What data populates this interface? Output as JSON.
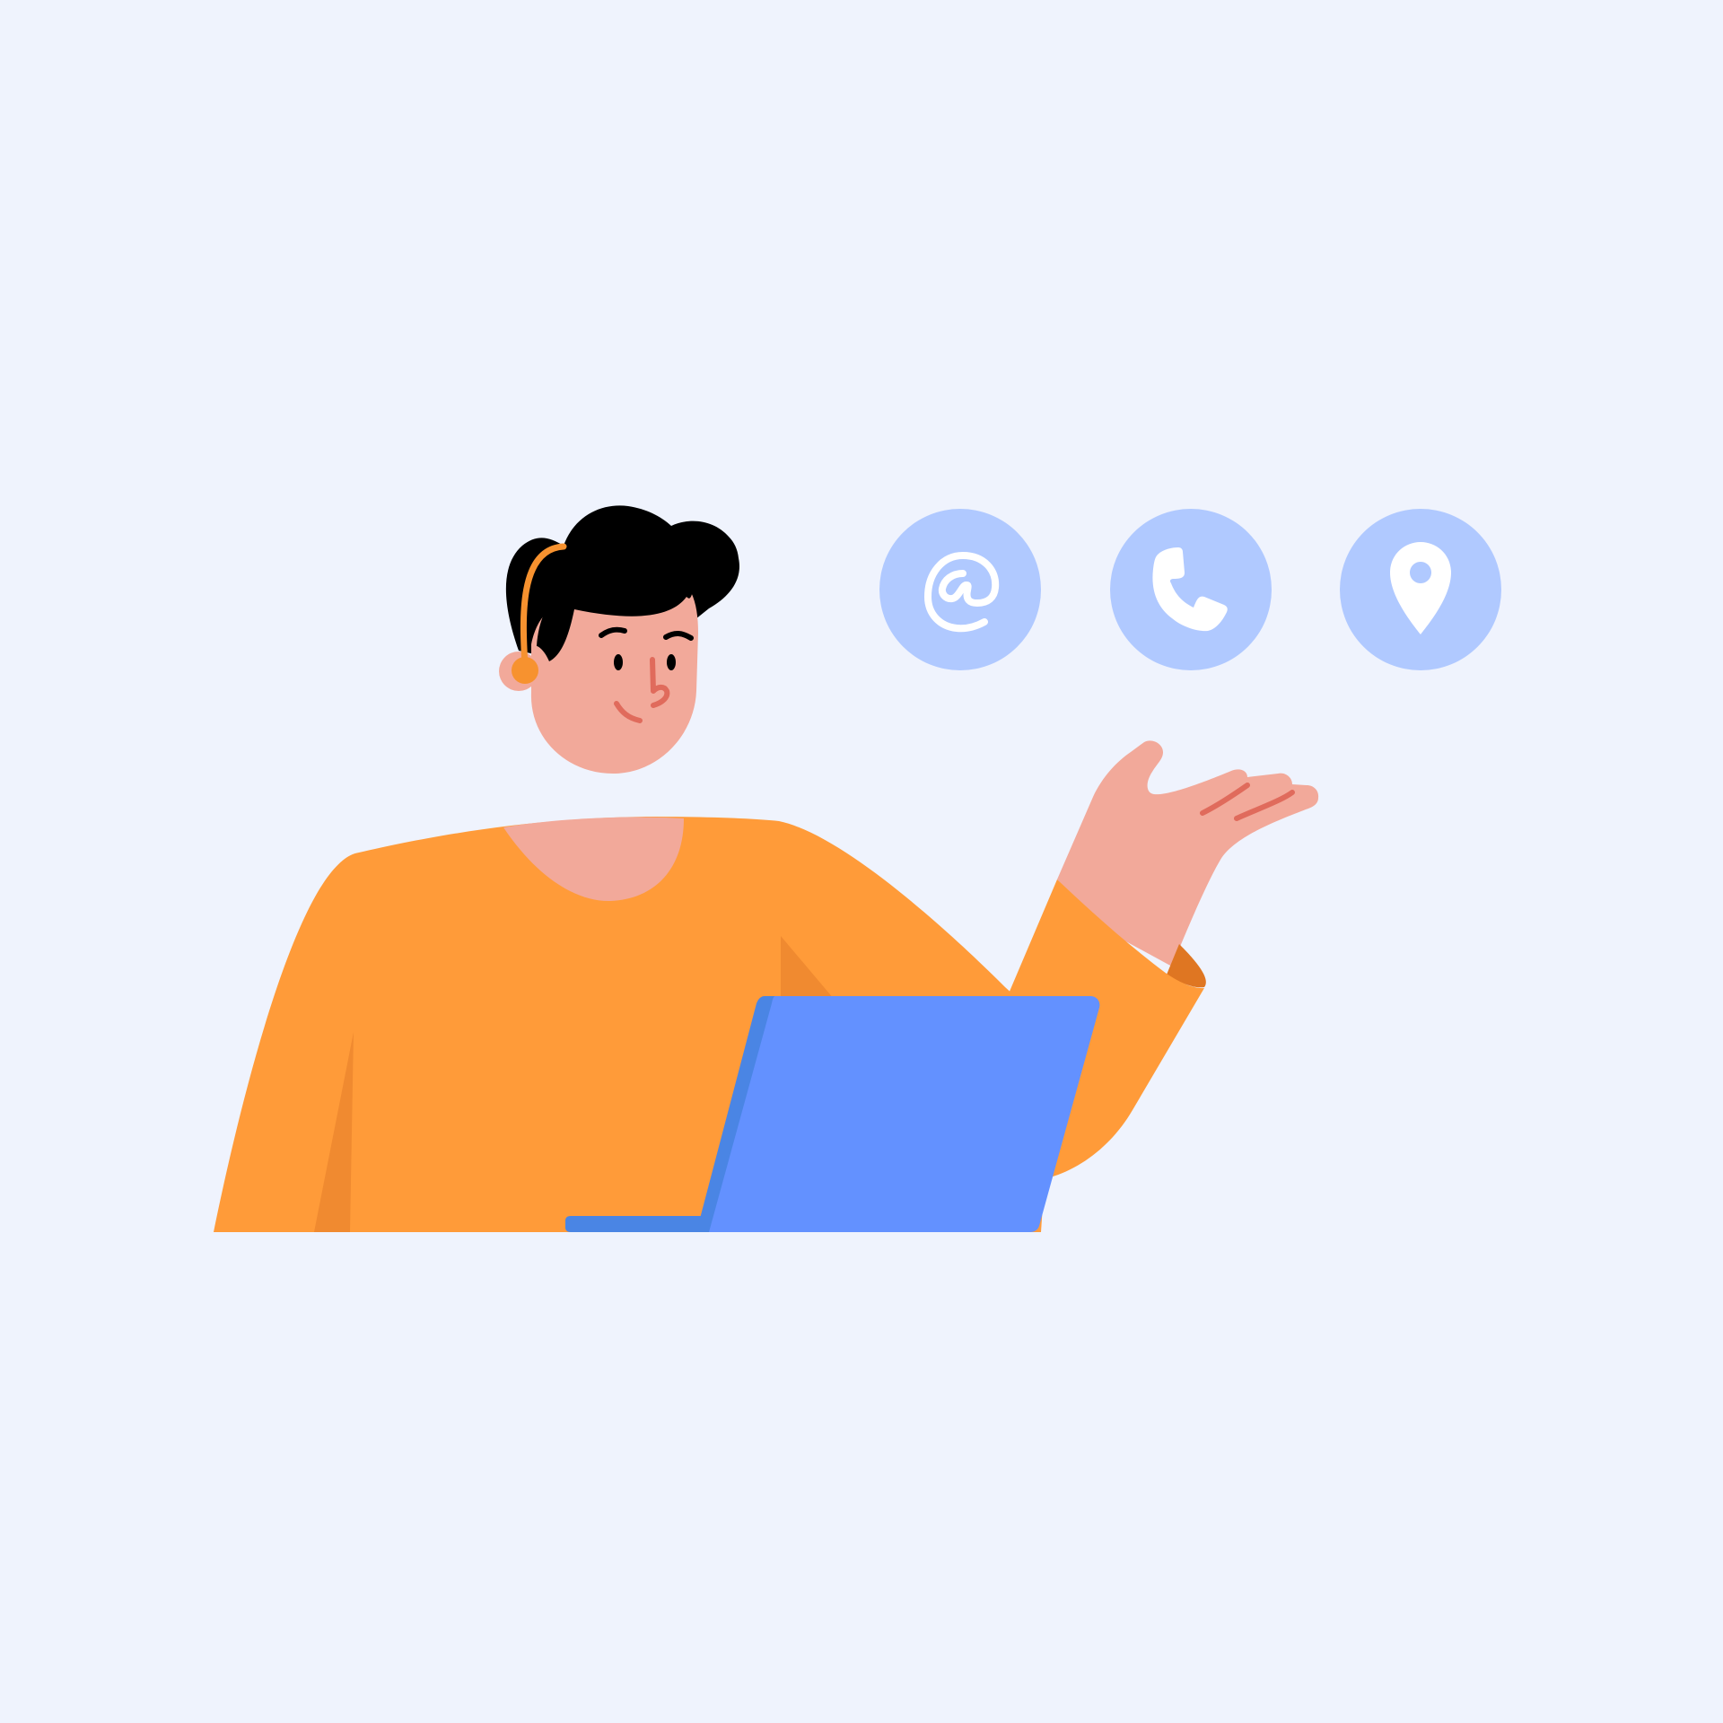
{
  "illustration": {
    "subject": "customer-support-agent",
    "colors": {
      "background": "#EFF3FD",
      "shirt": "#FF9B39",
      "shirt_shadow": "#F08A30",
      "cuff_shadow": "#DF7622",
      "skin": "#F2A99A",
      "skin_line": "#E06B5C",
      "hair": "#000000",
      "headset": "#F7922F",
      "laptop": "#6391FF",
      "laptop_edge": "#4A85E4",
      "contact_circle": "#B0C9FF",
      "icon": "#FFFFFF"
    }
  },
  "contact_icons": [
    {
      "icon": "at-sign-icon"
    },
    {
      "icon": "phone-icon"
    },
    {
      "icon": "location-pin-icon"
    }
  ]
}
